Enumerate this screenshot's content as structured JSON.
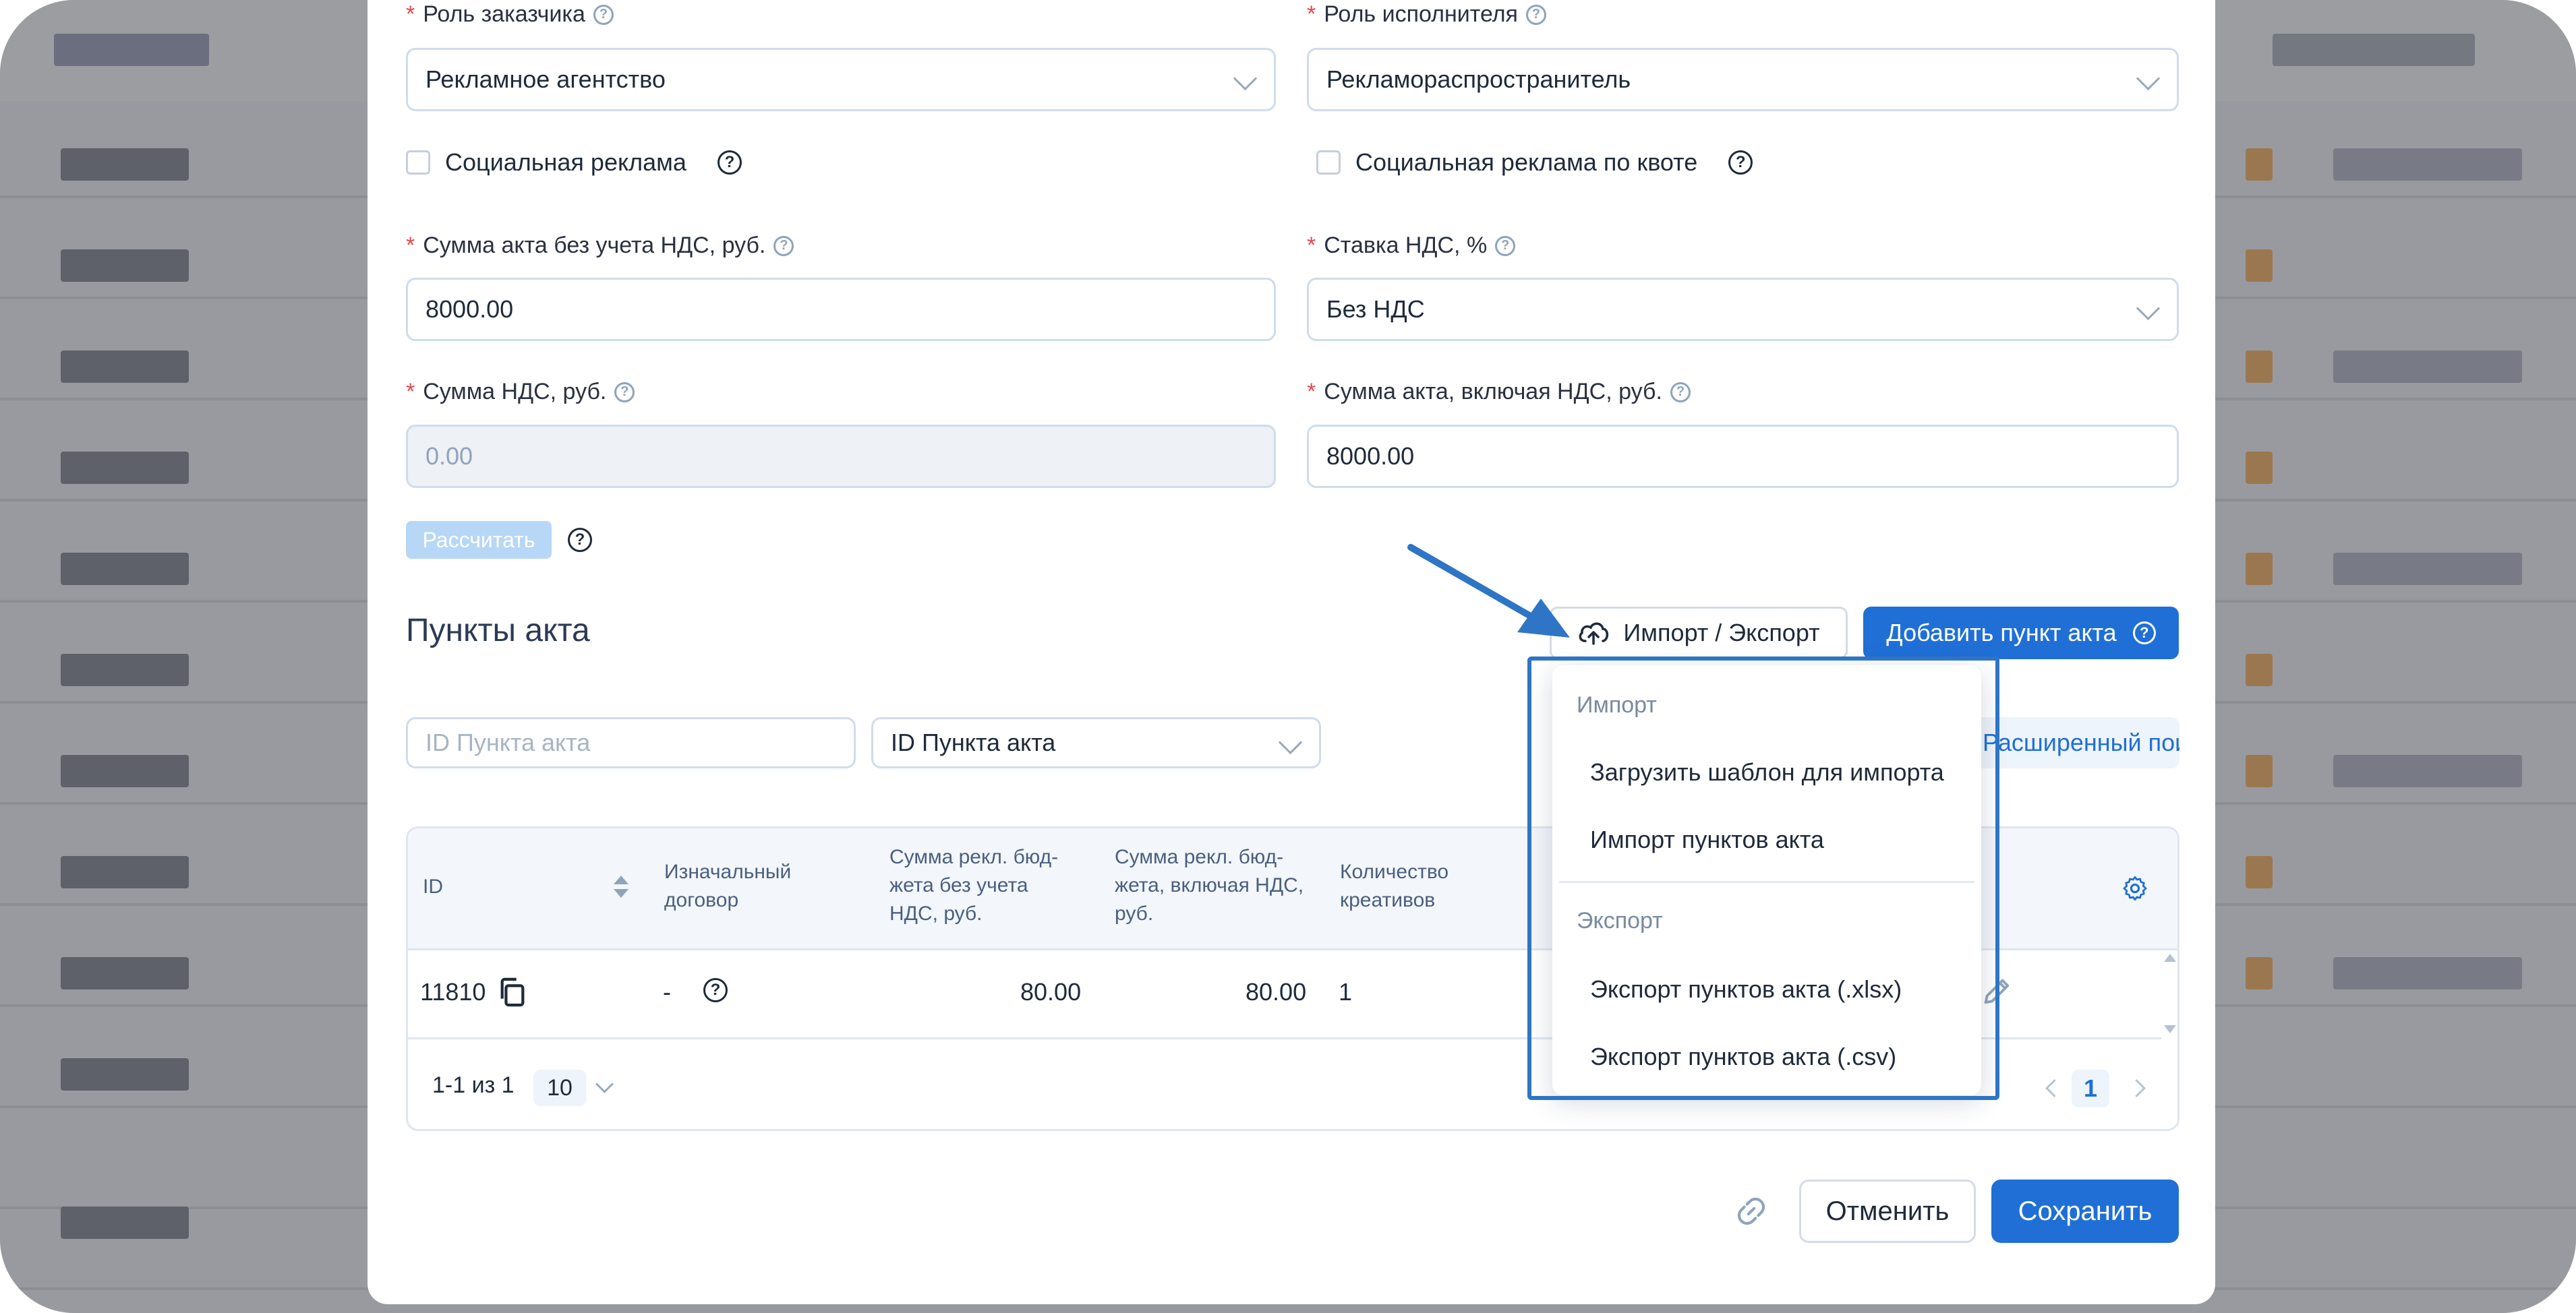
{
  "form": {
    "customer_role": {
      "label": "Роль заказчика",
      "value": "Рекламное агентство"
    },
    "performer_role": {
      "label": "Роль исполнителя",
      "value": "Рекламораспространитель"
    },
    "social_ad": {
      "label": "Социальная реклама"
    },
    "social_ad_quota": {
      "label": "Социальная реклама по квоте"
    },
    "sum_no_vat": {
      "label": "Сумма акта без учета НДС, руб.",
      "value": "8000.00"
    },
    "vat_rate": {
      "label": "Ставка НДС, %",
      "value": "Без НДС"
    },
    "vat_sum": {
      "label": "Сумма НДС, руб.",
      "value": "0.00"
    },
    "sum_with_vat": {
      "label": "Сумма акта, включая НДС, руб.",
      "value": "8000.00"
    },
    "calc_button": "Рассчитать",
    "required_mark": "*"
  },
  "items_section": {
    "title": "Пункты акта",
    "import_export_button": "Импорт / Экспорт",
    "add_button": "Добавить пункт акта",
    "search_placeholder": "ID Пункта акта",
    "search_field_select": "ID Пункта акта",
    "extended_search": "Расширенный поиск"
  },
  "table": {
    "columns": [
      "ID",
      "Изначальный договор",
      "Сумма рекл. бюджета без учета НДС, руб.",
      "Сумма рекл. бюджета, включая НДС, руб.",
      "Количество креативов"
    ],
    "col_lines": [
      [
        "ID"
      ],
      [
        "Изначальный",
        "договор"
      ],
      [
        "Сумма рекл. бюд-",
        "жета без учета",
        "НДС, руб."
      ],
      [
        "Сумма рекл. бюд-",
        "жета, включая НДС,",
        "руб."
      ],
      [
        "Количество",
        "креативов"
      ]
    ],
    "rows": [
      {
        "id": "11810",
        "contract": "-",
        "sum_no_vat": "80.00",
        "sum_with_vat": "80.00",
        "creatives": "1"
      }
    ],
    "pagination": {
      "range": "1-1 из 1",
      "page_size": "10",
      "current_page": "1"
    }
  },
  "dropdown": {
    "import_group": "Импорт",
    "import_items": [
      "Загрузить шаблон для импорта",
      "Импорт пунктов акта"
    ],
    "export_group": "Экспорт",
    "export_items": [
      "Экспорт пунктов акта (.xlsx)",
      "Экспорт пунктов акта (.csv)"
    ]
  },
  "footer": {
    "cancel": "Отменить",
    "save": "Сохранить"
  },
  "colors": {
    "primary": "#1f6fd6",
    "annotation": "#2e75c5",
    "required": "#e5484d"
  }
}
